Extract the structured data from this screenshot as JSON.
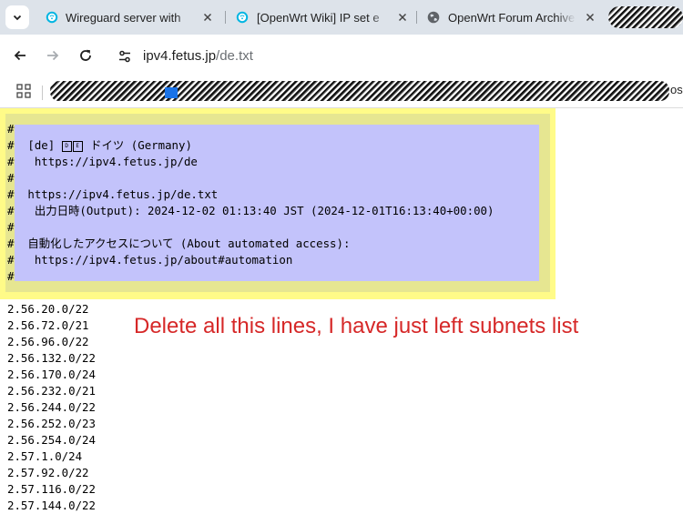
{
  "tabs": [
    {
      "title": "Wireguard server with",
      "favicon": "openwrt-icon",
      "active": false
    },
    {
      "title": "[OpenWrt Wiki] IP set e",
      "favicon": "openwrt-icon",
      "active": false
    },
    {
      "title": "OpenWrt Forum Archive",
      "favicon": "globe-icon",
      "active": false
    }
  ],
  "toolbar": {
    "url_host": "ipv4.fetus.jp",
    "url_path": "/de.txt"
  },
  "bookmarks": {
    "trailing_text": "os"
  },
  "header_lines": [
    "#",
    "#  [de] {FLAG} ドイツ (Germany)",
    "#   https://ipv4.fetus.jp/de",
    "#",
    "#  https://ipv4.fetus.jp/de.txt",
    "#   出力日時(Output): 2024-12-02 01:13:40 JST (2024-12-01T16:13:40+00:00)",
    "#",
    "#  自動化したアクセスについて (About automated access):",
    "#   https://ipv4.fetus.jp/about#automation",
    "#"
  ],
  "flag_glyphs": [
    "D",
    "E"
  ],
  "subnets": [
    "2.56.20.0/22",
    "2.56.72.0/21",
    "2.56.96.0/22",
    "2.56.132.0/22",
    "2.56.170.0/24",
    "2.56.232.0/21",
    "2.56.244.0/22",
    "2.56.252.0/23",
    "2.56.254.0/24",
    "2.57.1.0/24",
    "2.57.92.0/22",
    "2.57.116.0/22",
    "2.57.144.0/22"
  ],
  "annotation": "Delete all this lines, I have just left subnets list",
  "colors": {
    "highlight_outer": "#fffb88",
    "highlight_mid": "#e6e691",
    "highlight_inner": "#c3c3fb",
    "annotation": "#d62828"
  }
}
